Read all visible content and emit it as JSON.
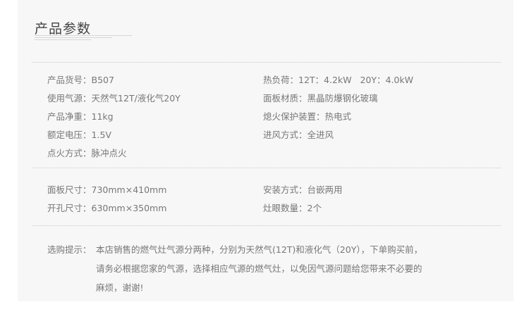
{
  "title": "产品参数",
  "section1": {
    "left": [
      {
        "label": "产品货号：",
        "value": "B507"
      },
      {
        "label": "使用气源：",
        "value": "天然气12T/液化气20Y"
      },
      {
        "label": "产品净重：",
        "value": "11kg"
      },
      {
        "label": "额定电压：",
        "value": "1.5V"
      },
      {
        "label": "点火方式：",
        "value": "脉冲点火"
      }
    ],
    "right": [
      {
        "label": "热负荷：",
        "value": "12T：4.2kW   20Y：4.0kW"
      },
      {
        "label": "面板材质：",
        "value": "黑晶防爆钢化玻璃"
      },
      {
        "label": "熄火保护装置：",
        "value": "热电式"
      },
      {
        "label": "进风方式：",
        "value": "全进风"
      }
    ]
  },
  "section2": {
    "left": [
      {
        "label": "面板尺寸：",
        "value": "730mm×410mm"
      },
      {
        "label": "开孔尺寸：",
        "value": "630mm×350mm"
      }
    ],
    "right": [
      {
        "label": "安装方式：",
        "value": "台嵌两用"
      },
      {
        "label": "灶眼数量：",
        "value": "2个"
      }
    ]
  },
  "tip": {
    "label": "选购提示：",
    "lines": [
      "本店销售的燃气灶气源分两种，分别为天然气(12T)和液化气（20Y），下单购买前，",
      "请务必根据您家的气源，选择相应气源的燃气灶，以免因气源问题给您带来不必要的",
      "麻烦，谢谢!"
    ]
  }
}
